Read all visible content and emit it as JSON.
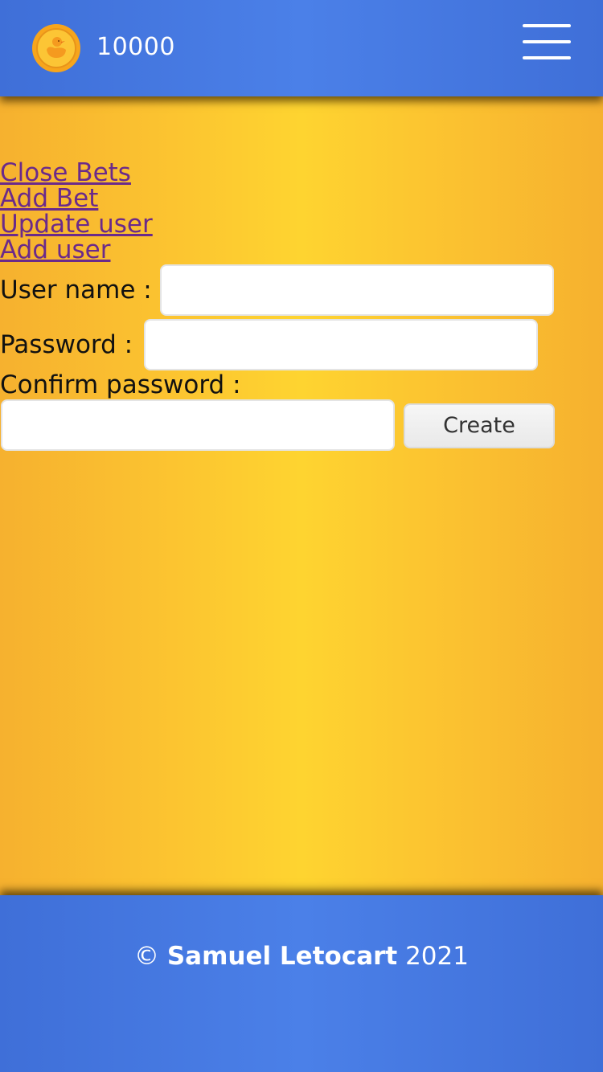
{
  "header": {
    "coin_icon": "duck-coin-icon",
    "balance": "10000",
    "menu_icon": "hamburger-menu-icon"
  },
  "nav": {
    "links": [
      {
        "label": "Close Bets"
      },
      {
        "label": "Add Bet"
      },
      {
        "label": "Update user"
      },
      {
        "label": "Add user"
      }
    ]
  },
  "form": {
    "username_label": "User name :",
    "username_value": "",
    "password_label": "Password :",
    "password_value": "",
    "confirm_label": "Confirm password :",
    "confirm_value": "",
    "submit_label": "Create"
  },
  "footer": {
    "copyright_symbol": "©",
    "author": "Samuel Letocart",
    "year": "2021"
  },
  "colors": {
    "header_blue": "#4b80e8",
    "background_yellow": "#fed430",
    "link_purple": "#6b2a8a",
    "coin_orange": "#f7b12c"
  }
}
